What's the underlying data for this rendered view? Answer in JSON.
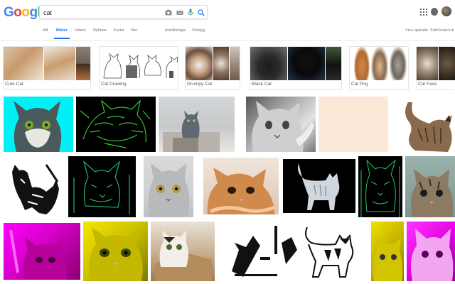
{
  "header": {
    "logo_letters": [
      {
        "ch": "G",
        "color": "#4285F4"
      },
      {
        "ch": "o",
        "color": "#EA4335"
      },
      {
        "ch": "o",
        "color": "#FBBC05"
      },
      {
        "ch": "g",
        "color": "#4285F4"
      },
      {
        "ch": "l",
        "color": "#34A853"
      },
      {
        "ch": "e",
        "color": "#EA4335"
      }
    ],
    "search_value": "cat"
  },
  "tabs": [
    {
      "label": "Allt",
      "active": false
    },
    {
      "label": "Bilder",
      "active": true
    },
    {
      "label": "Videor",
      "active": false
    },
    {
      "label": "Nyheter",
      "active": false
    },
    {
      "label": "Kartor",
      "active": false
    },
    {
      "label": "Mer",
      "active": false
    },
    {
      "label": "Inställningar",
      "active": false
    },
    {
      "label": "Verktyg",
      "active": false
    }
  ],
  "tabs_right": {
    "saved": "Visa sparade",
    "safesearch": "SafeSearch ▾"
  },
  "related": [
    {
      "label": "Cute Cat"
    },
    {
      "label": "Cat Drawing"
    },
    {
      "label": "Grumpy Cat"
    },
    {
      "label": "Black Cat"
    },
    {
      "label": "Cat Png"
    },
    {
      "label": "Cat Face"
    }
  ],
  "colors": {
    "accent": "#1a73e8",
    "cyan_tile": "#00f0f6",
    "magenta_tile": "#ff00ff",
    "yellow_tile": "#f6e600",
    "cream_tile": "#fbe8d6"
  }
}
